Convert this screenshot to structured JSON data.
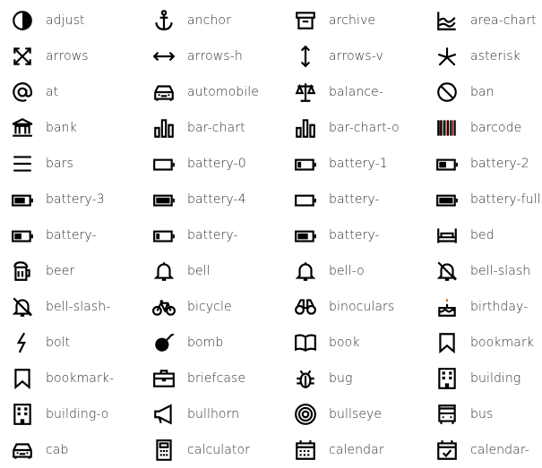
{
  "icons": [
    {
      "label": "adjust",
      "icon": "adjust"
    },
    {
      "label": "anchor",
      "icon": "anchor"
    },
    {
      "label": "archive",
      "icon": "archive"
    },
    {
      "label": "area-chart",
      "icon": "area-chart"
    },
    {
      "label": "arrows",
      "icon": "arrows"
    },
    {
      "label": "arrows-h",
      "icon": "arrows-h"
    },
    {
      "label": "arrows-v",
      "icon": "arrows-v"
    },
    {
      "label": "asterisk",
      "icon": "asterisk"
    },
    {
      "label": "at",
      "icon": "at"
    },
    {
      "label": "automobile",
      "icon": "automobile"
    },
    {
      "label": "balance-",
      "icon": "balance-scale"
    },
    {
      "label": "ban",
      "icon": "ban"
    },
    {
      "label": "bank",
      "icon": "bank"
    },
    {
      "label": "bar-chart",
      "icon": "bar-chart"
    },
    {
      "label": "bar-chart-o",
      "icon": "bar-chart-o"
    },
    {
      "label": "barcode",
      "icon": "barcode"
    },
    {
      "label": "bars",
      "icon": "bars"
    },
    {
      "label": "battery-0",
      "icon": "battery-0"
    },
    {
      "label": "battery-1",
      "icon": "battery-1"
    },
    {
      "label": "battery-2",
      "icon": "battery-2"
    },
    {
      "label": "battery-3",
      "icon": "battery-3"
    },
    {
      "label": "battery-4",
      "icon": "battery-4"
    },
    {
      "label": "battery-",
      "icon": "battery-0"
    },
    {
      "label": "battery-full",
      "icon": "battery-4"
    },
    {
      "label": "battery-",
      "icon": "battery-2"
    },
    {
      "label": "battery-",
      "icon": "battery-1"
    },
    {
      "label": "battery-",
      "icon": "battery-3"
    },
    {
      "label": "bed",
      "icon": "bed"
    },
    {
      "label": "beer",
      "icon": "beer"
    },
    {
      "label": "bell",
      "icon": "bell"
    },
    {
      "label": "bell-o",
      "icon": "bell"
    },
    {
      "label": "bell-slash",
      "icon": "bell-slash"
    },
    {
      "label": "bell-slash-",
      "icon": "bell-slash"
    },
    {
      "label": "bicycle",
      "icon": "bicycle"
    },
    {
      "label": "binoculars",
      "icon": "binoculars"
    },
    {
      "label": "birthday-",
      "icon": "birthday-cake"
    },
    {
      "label": "bolt",
      "icon": "bolt"
    },
    {
      "label": "bomb",
      "icon": "bomb"
    },
    {
      "label": "book",
      "icon": "book"
    },
    {
      "label": "bookmark",
      "icon": "bookmark"
    },
    {
      "label": "bookmark-",
      "icon": "bookmark"
    },
    {
      "label": "briefcase",
      "icon": "briefcase"
    },
    {
      "label": "bug",
      "icon": "bug"
    },
    {
      "label": "building",
      "icon": "building"
    },
    {
      "label": "building-o",
      "icon": "building"
    },
    {
      "label": "bullhorn",
      "icon": "bullhorn"
    },
    {
      "label": "bullseye",
      "icon": "bullseye"
    },
    {
      "label": "bus",
      "icon": "bus"
    },
    {
      "label": "cab",
      "icon": "automobile"
    },
    {
      "label": "calculator",
      "icon": "calculator"
    },
    {
      "label": "calendar",
      "icon": "calendar"
    },
    {
      "label": "calendar-",
      "icon": "calendar-check"
    }
  ]
}
